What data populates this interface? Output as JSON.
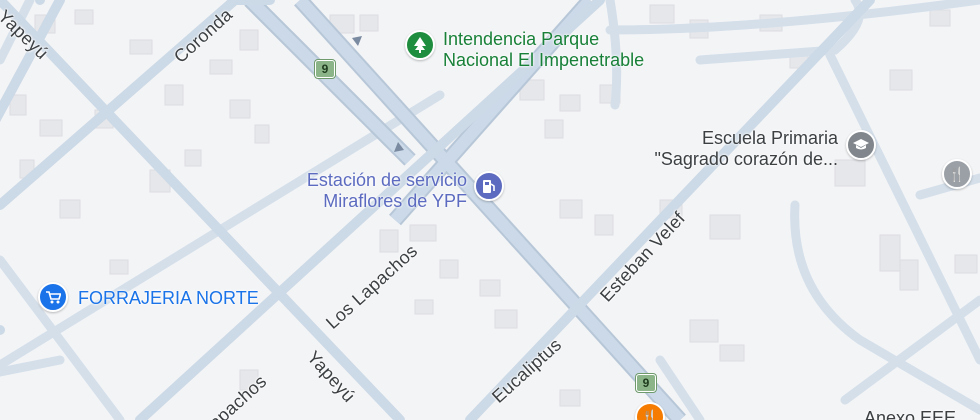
{
  "streets": {
    "yapeyu": "Yapeyú",
    "coronda": "Coronda",
    "los_lapachos": "Los Lapachos",
    "lapachos_partial": "apachos",
    "esteban_velef": "Esteban Velef",
    "eucaliptus": "Eucaliptus"
  },
  "route_shield": "9",
  "pois": {
    "park": {
      "line1": "Intendencia Parque",
      "line2": "Nacional El Impenetrable",
      "icon": "tree-icon",
      "color": "#1e8e3e",
      "text_color": "#188038"
    },
    "gas": {
      "line1": "Estación de servicio",
      "line2": "Miraflores de YPF",
      "icon": "gas-pump-icon",
      "color": "#5c6bc0",
      "text_color": "#5c6bc0"
    },
    "school": {
      "line1": "Escuela Primaria",
      "line2": "\"Sagrado corazón de...",
      "icon": "graduation-cap-icon",
      "color": "#80868b",
      "text_color": "#3c4043"
    },
    "shop": {
      "line1": "FORRAJERIA NORTE",
      "icon": "shopping-cart-icon",
      "color": "#1a73e8",
      "text_color": "#1a73e8"
    },
    "restaurant_right": {
      "icon": "fork-knife-icon",
      "color": "#9aa0a6"
    },
    "restaurant_bottom": {
      "icon": "fork-knife-icon",
      "color": "#f57c00"
    },
    "annex": {
      "line1": "Anexo EEE"
    }
  },
  "colors": {
    "road_main": "#c8d7e6",
    "road_minor": "#d8e2ec",
    "road_outline": "#b7c7d8",
    "building": "#e6e7ea",
    "background": "#f3f4f6"
  }
}
